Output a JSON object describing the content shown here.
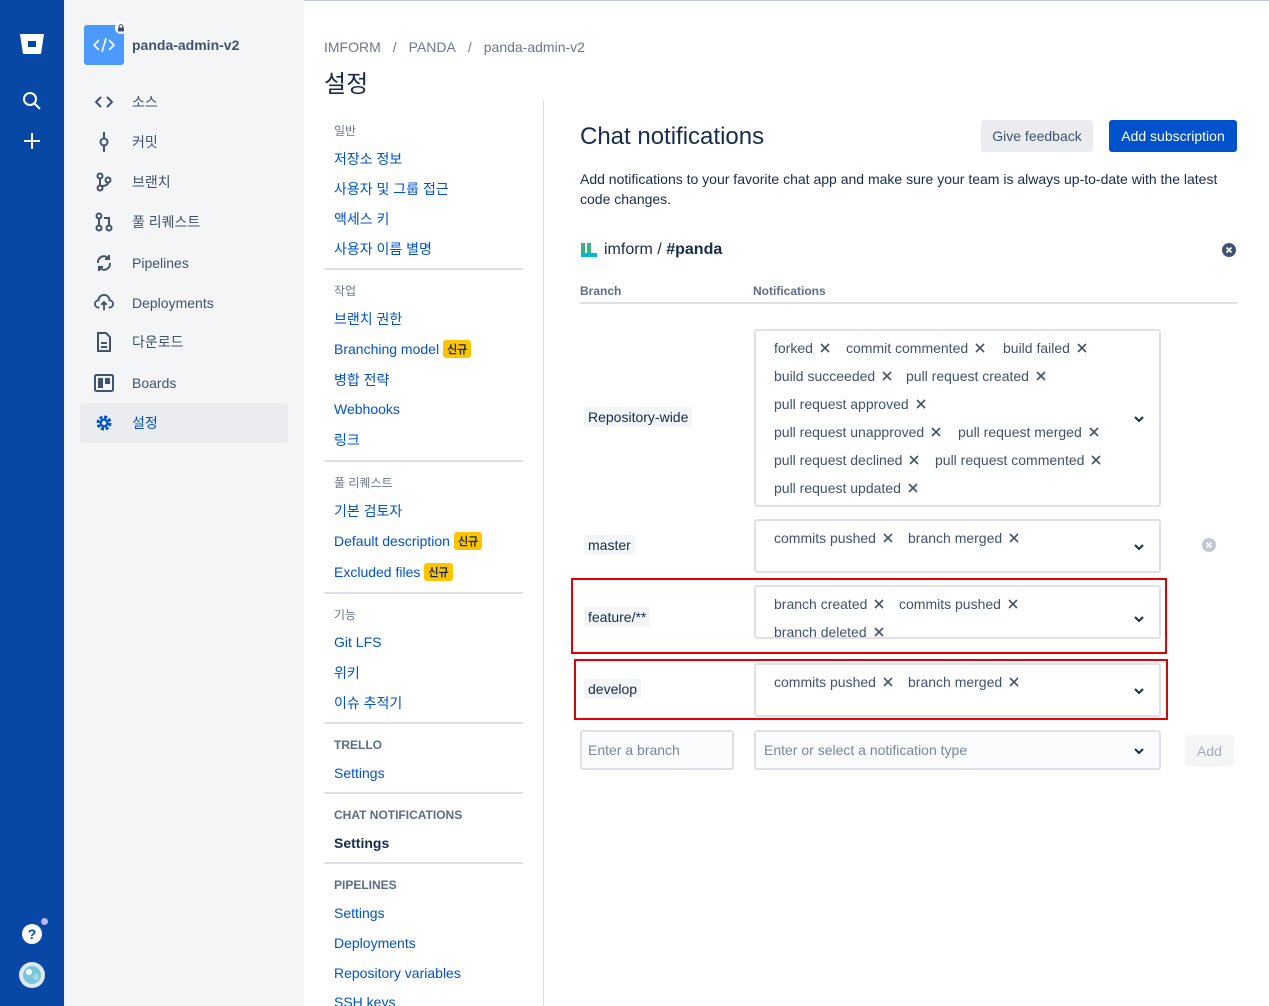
{
  "sidebar": {
    "repo_name": "panda-admin-v2",
    "items": [
      {
        "label": "소스",
        "icon": "source-icon"
      },
      {
        "label": "커밋",
        "icon": "commit-icon"
      },
      {
        "label": "브랜치",
        "icon": "branch-icon"
      },
      {
        "label": "풀 리퀘스트",
        "icon": "pull-request-icon"
      },
      {
        "label": "Pipelines",
        "icon": "pipelines-icon"
      },
      {
        "label": "Deployments",
        "icon": "deployments-icon"
      },
      {
        "label": "다운로드",
        "icon": "downloads-icon"
      },
      {
        "label": "Boards",
        "icon": "boards-icon"
      },
      {
        "label": "설정",
        "icon": "settings-icon"
      }
    ]
  },
  "breadcrumb": [
    "IMFORM",
    "PANDA",
    "panda-admin-v2"
  ],
  "page_title": "설정",
  "settings_nav": {
    "general": {
      "heading": "일반",
      "links": [
        "저장소 정보",
        "사용자 및 그룹 접근",
        "액세스 키",
        "사용자 이름 별명"
      ]
    },
    "workflow": {
      "heading": "작업",
      "links": [
        "브랜치 권한",
        "Branching model",
        "병합 전략",
        "Webhooks",
        "링크"
      ]
    },
    "pullrequests": {
      "heading": "풀 리퀘스트",
      "links": [
        "기본 검토자",
        "Default description",
        "Excluded files"
      ]
    },
    "features": {
      "heading": "기능",
      "links": [
        "Git LFS",
        "위키",
        "이슈 추적기"
      ]
    },
    "trello": {
      "heading": "TRELLO",
      "links": [
        "Settings"
      ]
    },
    "chat": {
      "heading": "CHAT NOTIFICATIONS",
      "links": [
        "Settings"
      ]
    },
    "pipelines": {
      "heading": "PIPELINES",
      "links": [
        "Settings",
        "Deployments",
        "Repository variables",
        "SSH keys"
      ]
    },
    "new_badge": "신규"
  },
  "main": {
    "title": "Chat notifications",
    "give_feedback": "Give feedback",
    "add_subscription": "Add subscription",
    "description": "Add notifications to your favorite chat app and make sure your team is always up-to-date with the latest code changes.",
    "channel_workspace": "imform /",
    "channel_name": "#panda",
    "col_branch": "Branch",
    "col_notifications": "Notifications",
    "rows": [
      {
        "branch": "Repository-wide",
        "chips": [
          "forked",
          "commit commented",
          "build failed",
          "build succeeded",
          "pull request created",
          "pull request approved",
          "pull request unapproved",
          "pull request merged",
          "pull request declined",
          "pull request commented",
          "pull request updated"
        ]
      },
      {
        "branch": "master",
        "chips": [
          "commits pushed",
          "branch merged"
        ]
      },
      {
        "branch": "feature/**",
        "chips": [
          "branch created",
          "commits pushed",
          "branch deleted"
        ]
      },
      {
        "branch": "develop",
        "chips": [
          "commits pushed",
          "branch merged"
        ]
      }
    ],
    "branch_placeholder": "Enter a branch",
    "type_placeholder": "Enter or select a notification type",
    "add_button": "Add"
  },
  "colors": {
    "nav": "#0747a6",
    "primary": "#0052cc",
    "highlight": "#e60000",
    "badge": "#ffc400"
  }
}
